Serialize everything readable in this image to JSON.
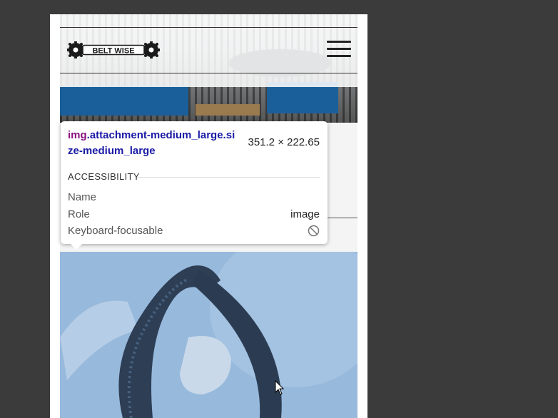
{
  "site": {
    "logo_text": "BELT WISE",
    "menu_icon": "hamburger-menu-icon"
  },
  "images": {
    "top": "factory-floor-photo",
    "bottom": "timing-belt-photo"
  },
  "inspector": {
    "selector_tag": "img",
    "selector_classes": ".attachment-medium_large.size-medium_large",
    "dimensions": "351.2 × 222.65",
    "section": "ACCESSIBILITY",
    "rows": [
      {
        "label": "Name",
        "value": ""
      },
      {
        "label": "Role",
        "value": "image"
      },
      {
        "label": "Keyboard-focusable",
        "value": "",
        "icon": "not-allowed-icon"
      }
    ]
  },
  "colors": {
    "tag": "#881280",
    "classes": "#1a1aa6",
    "cart_blue": "#1b5f9a",
    "belt_overlay": "#8fb1d6"
  }
}
